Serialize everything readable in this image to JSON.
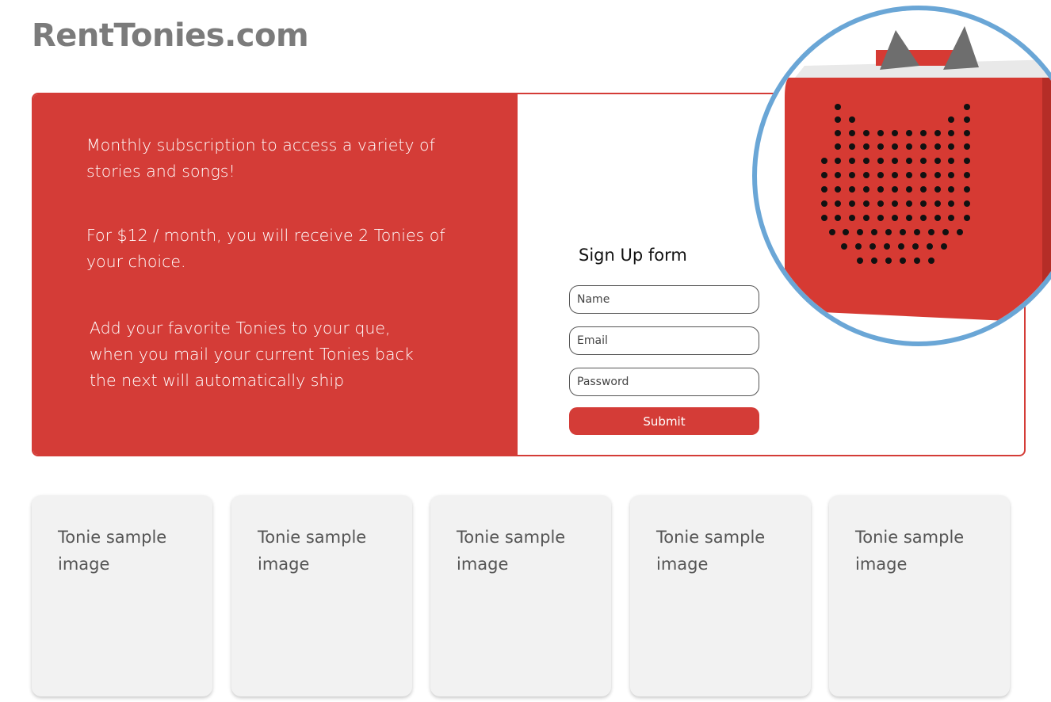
{
  "site": {
    "logo": "RentTonies.com"
  },
  "hero": {
    "paragraphs": [
      "Monthly subscription to access a variety of stories and songs!",
      "For $12 / month, you will receive 2 Tonies of your choice.",
      "Add your favorite Tonies to your que, when you mail your current Tonies back the next will automatically ship"
    ]
  },
  "signup": {
    "title": "Sign Up form",
    "name_placeholder": "Name",
    "email_placeholder": "Email",
    "password_placeholder": "Password",
    "submit_label": "Submit"
  },
  "product_image": {
    "icon": "toniebox-speaker-image",
    "color": "#d63a33",
    "ring_color": "#6aa6d6"
  },
  "cards": [
    {
      "label": "Tonie sample image"
    },
    {
      "label": "Tonie sample image"
    },
    {
      "label": "Tonie sample image"
    },
    {
      "label": "Tonie sample image"
    },
    {
      "label": "Tonie sample image"
    }
  ],
  "colors": {
    "brand_red": "#d43c37",
    "logo_gray": "#7b7b7b",
    "card_bg": "#f2f2f2"
  }
}
